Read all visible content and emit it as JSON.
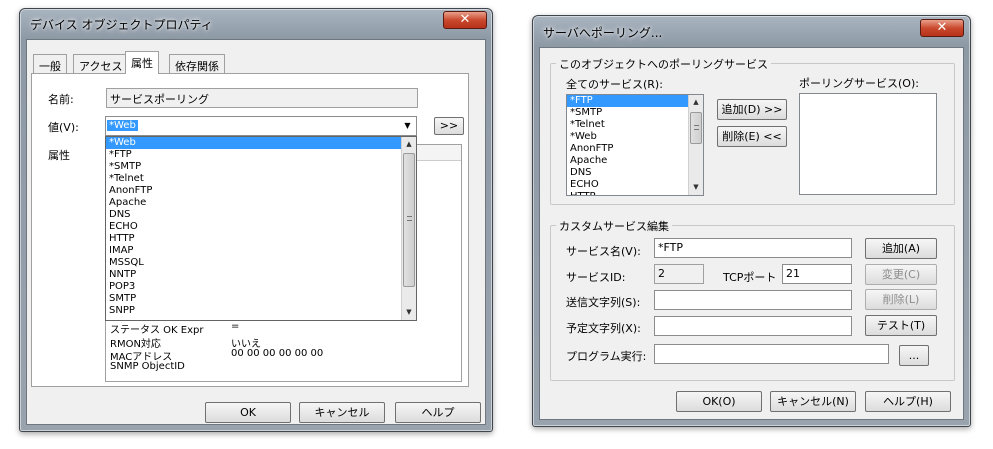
{
  "left_dialog": {
    "title": "デバイス オブジェクトプロパティ",
    "close_glyph": "✕",
    "tabs": [
      {
        "label": "一般"
      },
      {
        "label": "アクセス"
      },
      {
        "label": "属性"
      },
      {
        "label": "依存関係"
      }
    ],
    "name_label": "名前:",
    "name_value": "サービスポーリング",
    "value_label": "値(V):",
    "value_selected": "*Web",
    "expand_button": ">>",
    "attr_label": "属性",
    "dropdown_items": [
      "*Web",
      "*FTP",
      "*SMTP",
      "*Telnet",
      "AnonFTP",
      "Apache",
      "DNS",
      "ECHO",
      "HTTP",
      "IMAP",
      "MSSQL",
      "NNTP",
      "POP3",
      "SMTP",
      "SNPP"
    ],
    "attr_rows": [
      {
        "name": "ステータス OK Expr",
        "value": "="
      },
      {
        "name": "RMON対応",
        "value": "いいえ"
      },
      {
        "name": "MACアドレス",
        "value": "00 00 00 00 00 00"
      },
      {
        "name": "SNMP ObjectID",
        "value": ""
      }
    ],
    "ok_button": "OK",
    "cancel_button": "キャンセル",
    "help_button": "ヘルプ"
  },
  "right_dialog": {
    "title": "サーバへポーリング...",
    "close_glyph": "✕",
    "polling_group_title": "このオブジェクトへのポーリングサービス",
    "all_services_label": "全てのサービス(R):",
    "polling_services_label": "ポーリングサービス(O):",
    "all_services": [
      "*FTP",
      "*SMTP",
      "*Telnet",
      "*Web",
      "AnonFTP",
      "Apache",
      "DNS",
      "ECHO",
      "HTTP"
    ],
    "add_button": "追加(D) >>",
    "remove_button": "削除(E) <<",
    "custom_group_title": "カスタムサービス編集",
    "service_name_label": "サービス名(V):",
    "service_name_value": "*FTP",
    "service_id_label": "サービスID:",
    "service_id_value": "2",
    "tcp_port_label": "TCPポート",
    "tcp_port_value": "21",
    "send_string_label": "送信文字列(S):",
    "send_string_value": "",
    "expect_string_label": "予定文字列(X):",
    "expect_string_value": "",
    "program_label": "プログラム実行:",
    "program_value": "",
    "browse_button": "...",
    "custom_add_button": "追加(A)",
    "change_button": "変更(C)",
    "delete_button": "削除(L)",
    "test_button": "テスト(T)",
    "ok_button": "OK(O)",
    "cancel_button": "キャンセル(N)",
    "help_button": "ヘルプ(H)"
  }
}
